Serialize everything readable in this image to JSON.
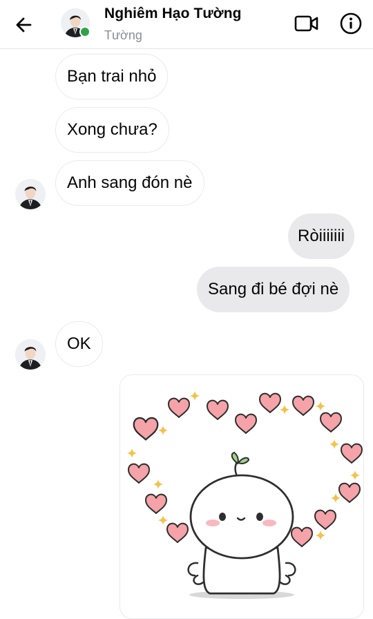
{
  "header": {
    "name": "Nghiêm Hạo Tường",
    "subtitle": "Tường"
  },
  "messages": [
    {
      "side": "incoming",
      "text": "Bạn trai nhỏ"
    },
    {
      "side": "incoming",
      "text": "Xong chưa?"
    },
    {
      "side": "incoming",
      "text": "Anh sang đón nè"
    },
    {
      "side": "outgoing",
      "text": "Ròiiiiiii"
    },
    {
      "side": "outgoing",
      "text": "Sang đi bé đợi nè"
    },
    {
      "side": "incoming",
      "text": "OK"
    }
  ],
  "colors": {
    "online": "#31a24c",
    "outgoing_bubble": "#e9e9eb",
    "heart": "#f07f86",
    "sparkle": "#f2c24b"
  },
  "icons": [
    "back-arrow-icon",
    "video-camera-icon",
    "info-icon",
    "online-status-icon"
  ],
  "sticker": {
    "name": "hearts-character-sticker"
  }
}
